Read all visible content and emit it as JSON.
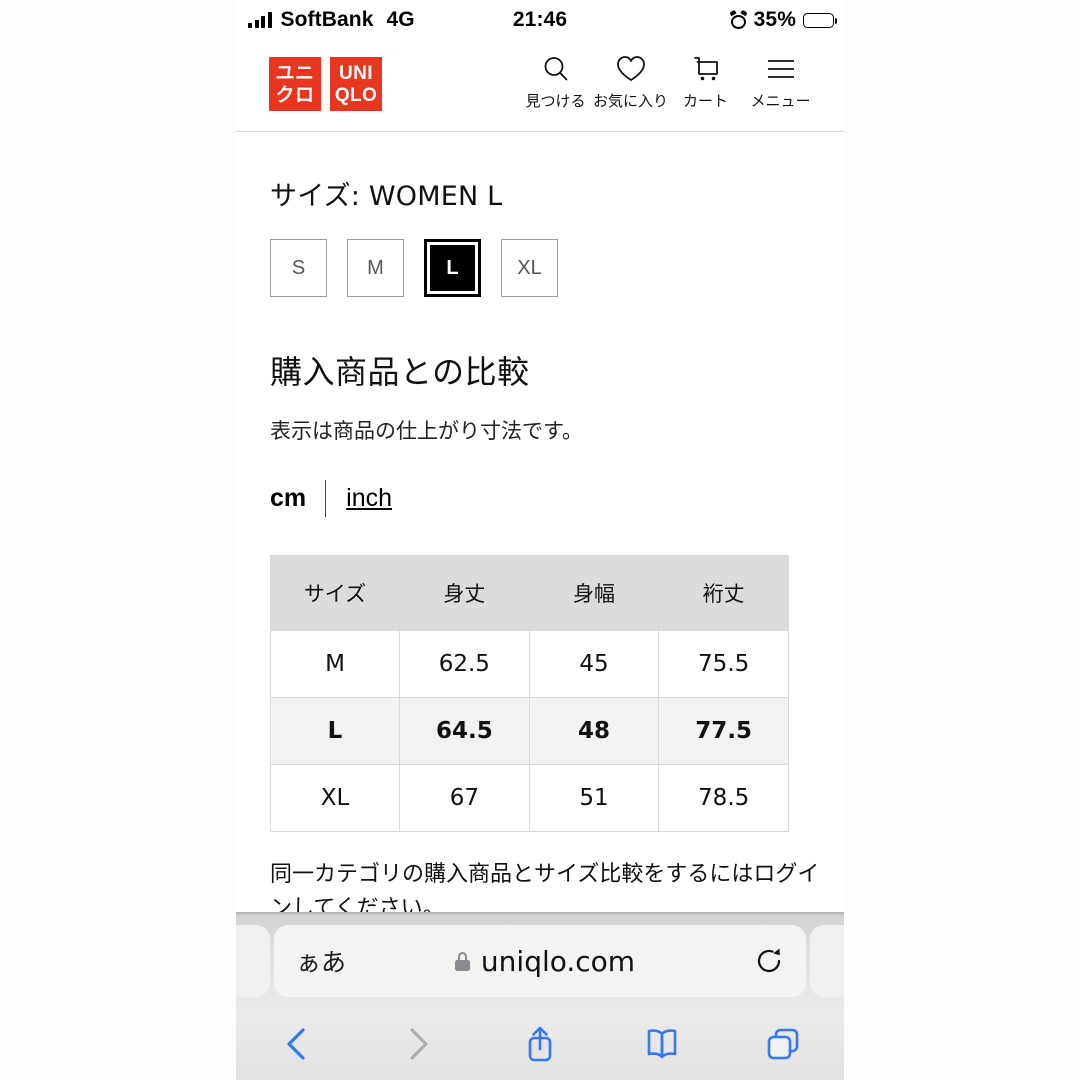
{
  "status_bar": {
    "carrier": "SoftBank",
    "network": "4G",
    "time": "21:46",
    "battery_percent": "35%",
    "alarm_icon": "alarm-icon",
    "signal_icon": "signal-bars-icon",
    "battery_icon": "battery-icon"
  },
  "header": {
    "logo": {
      "jp_line1": "ユニ",
      "jp_line2": "クロ",
      "en_line1": "UNI",
      "en_line2": "QLO",
      "color": "#e8371e"
    },
    "nav": [
      {
        "icon": "search-icon",
        "label": "見つける"
      },
      {
        "icon": "heart-icon",
        "label": "お気に入り"
      },
      {
        "icon": "cart-icon",
        "label": "カート"
      },
      {
        "icon": "menu-icon",
        "label": "メニュー"
      }
    ]
  },
  "size_section": {
    "title": "サイズ: WOMEN L",
    "options": [
      {
        "label": "S",
        "selected": false
      },
      {
        "label": "M",
        "selected": false
      },
      {
        "label": "L",
        "selected": true
      },
      {
        "label": "XL",
        "selected": false
      }
    ]
  },
  "comparison": {
    "heading": "購入商品との比較",
    "subtitle": "表示は商品の仕上がり寸法です。",
    "units": {
      "active": "cm",
      "alternate": "inch"
    },
    "note": "同一カテゴリの購入商品とサイズ比較をするにはログインしてください。"
  },
  "table": {
    "headers": [
      "サイズ",
      "身丈",
      "身幅",
      "裄丈"
    ],
    "rows": [
      {
        "size": "M",
        "values": [
          "62.5",
          "45",
          "75.5"
        ],
        "highlighted": false
      },
      {
        "size": "L",
        "values": [
          "64.5",
          "48",
          "77.5"
        ],
        "highlighted": true
      },
      {
        "size": "XL",
        "values": [
          "67",
          "51",
          "78.5"
        ],
        "highlighted": false
      }
    ]
  },
  "browser": {
    "text_size_label": "ぁあ",
    "lock_icon": "lock-icon",
    "url": "uniqlo.com",
    "reload_icon": "reload-icon",
    "toolbar": [
      {
        "icon": "back-icon",
        "enabled": true
      },
      {
        "icon": "forward-icon",
        "enabled": false
      },
      {
        "icon": "share-icon",
        "enabled": true
      },
      {
        "icon": "bookmarks-icon",
        "enabled": true
      },
      {
        "icon": "tabs-icon",
        "enabled": true
      }
    ],
    "accent_color": "#3478f6",
    "disabled_color": "#b0b0b0"
  }
}
